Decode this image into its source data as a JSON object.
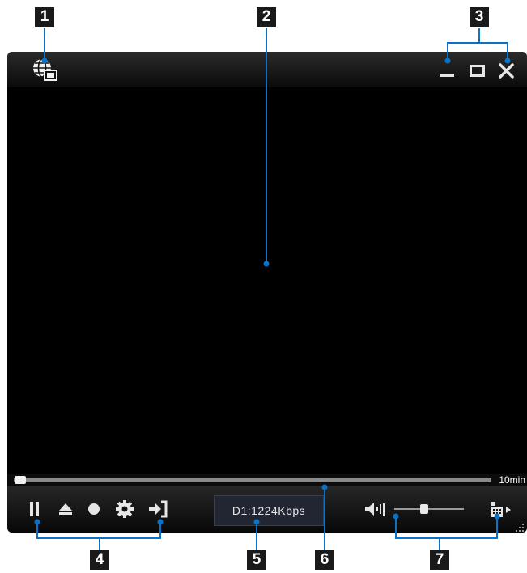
{
  "callouts": {
    "c1": "1",
    "c2": "2",
    "c3": "3",
    "c4": "4",
    "c5": "5",
    "c6": "6",
    "c7": "7"
  },
  "titlebar": {
    "app_icon": "globe-monitor-icon",
    "controls": [
      "minimize-icon",
      "maximize-icon",
      "close-icon"
    ]
  },
  "seek": {
    "total_time": "10min",
    "progress": 0.0
  },
  "controls": {
    "left": [
      "pause-icon",
      "eject-icon",
      "record-icon",
      "settings-gear-icon",
      "exit-icon"
    ],
    "bitrate": "D1:1224Kbps",
    "right": [
      "volume-icon",
      "volume-slider",
      "stream-select-icon"
    ],
    "volume_level": 0.42
  },
  "colors": {
    "callout_line": "#0a73c8",
    "callout_box": "#1a1a1a",
    "player_bg": "#000000",
    "icon": "#e6e6e6"
  }
}
